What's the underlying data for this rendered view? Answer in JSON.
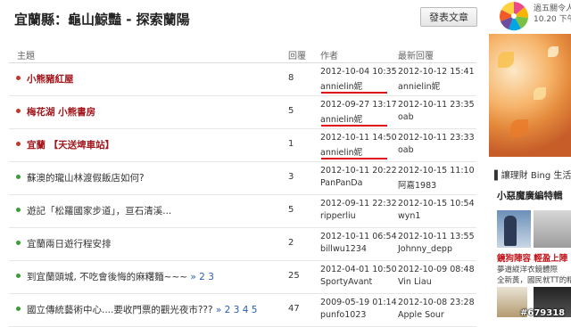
{
  "page_title": "宜蘭縣：龜山鯨豔 - 探索蘭陽",
  "post_button": "發表文章",
  "columns": {
    "topic": "主題",
    "replies": "回覆",
    "author": "作者",
    "last_reply": "最新回覆"
  },
  "colors": {
    "hot": "#a3161b",
    "green": "#3a9d3a",
    "red_bullet": "#c0392b",
    "underline": "#e0101a"
  },
  "rows": [
    {
      "topic": "小熊豬紅屋",
      "pages": "",
      "hot": true,
      "bullet": "red",
      "replies": "8",
      "created": "2012-10-04 10:35",
      "author": "annielin妮",
      "last_time": "2012-10-12 15:41",
      "last_author": "annielin妮",
      "underlined": true
    },
    {
      "topic": "梅花湖 小熊書房",
      "pages": "",
      "hot": true,
      "bullet": "red",
      "replies": "5",
      "created": "2012-09-27 13:17",
      "author": "annielin妮",
      "last_time": "2012-10-11 23:35",
      "last_author": "oab",
      "underlined": true
    },
    {
      "topic": "宜蘭 【天送埤車站】",
      "pages": "",
      "hot": true,
      "bullet": "red",
      "replies": "1",
      "created": "2012-10-11 14:50",
      "author": "annielin妮",
      "last_time": "2012-10-11 23:33",
      "last_author": "oab",
      "underlined": true
    },
    {
      "topic": "蘇澳的瓏山林渡假飯店如何?",
      "pages": "",
      "hot": false,
      "bullet": "green",
      "replies": "3",
      "created": "2012-10-11 20:22",
      "author": "PanPanDa",
      "last_time": "2012-10-15 11:10",
      "last_author": "阿嘉1983",
      "underlined": false
    },
    {
      "topic": "遊記「松羅國家步道」，亘石清溪...",
      "pages": "",
      "hot": false,
      "bullet": "green",
      "replies": "5",
      "created": "2012-09-11 22:32",
      "author": "ripperliu",
      "last_time": "2012-10-15 10:54",
      "last_author": "wyn1",
      "underlined": false
    },
    {
      "topic": "宜蘭兩日遊行程安排",
      "pages": "",
      "hot": false,
      "bullet": "green",
      "replies": "2",
      "created": "2012-10-11 06:54",
      "author": "billwu1234",
      "last_time": "2012-10-11 13:55",
      "last_author": "Johnny_depp",
      "underlined": false
    },
    {
      "topic": "到宜蘭頭城, 不吃會後悔的麻糬麵~~~",
      "pages": "» 2 3",
      "hot": false,
      "bullet": "green",
      "replies": "25",
      "created": "2012-04-01 10:50",
      "author": "SportyAvant",
      "last_time": "2012-10-09 08:48",
      "last_author": "Vin Liau",
      "underlined": false
    },
    {
      "topic": "國立傳統藝術中心....要收門票的觀光夜市???",
      "pages": "» 2 3 4 5",
      "hot": false,
      "bullet": "green",
      "replies": "47",
      "created": "2009-05-19 01:14",
      "author": "punfo1023",
      "last_time": "2012-10-08 23:28",
      "last_author": "Apple Sour",
      "underlined": false
    }
  ],
  "sidebar": {
    "ad_line1": "過五關令人",
    "ad_line2": "10.20 下午",
    "link": "▌讓理財 Bing 生活",
    "section_title": "小惡魔廣編特輯",
    "red_caption": "鏡狗陣容 輕盈上陣",
    "small1": "夢道縱洋衣鏡體際",
    "small2": "全新黃，國民就TT的精",
    "watermark": "#679318"
  }
}
